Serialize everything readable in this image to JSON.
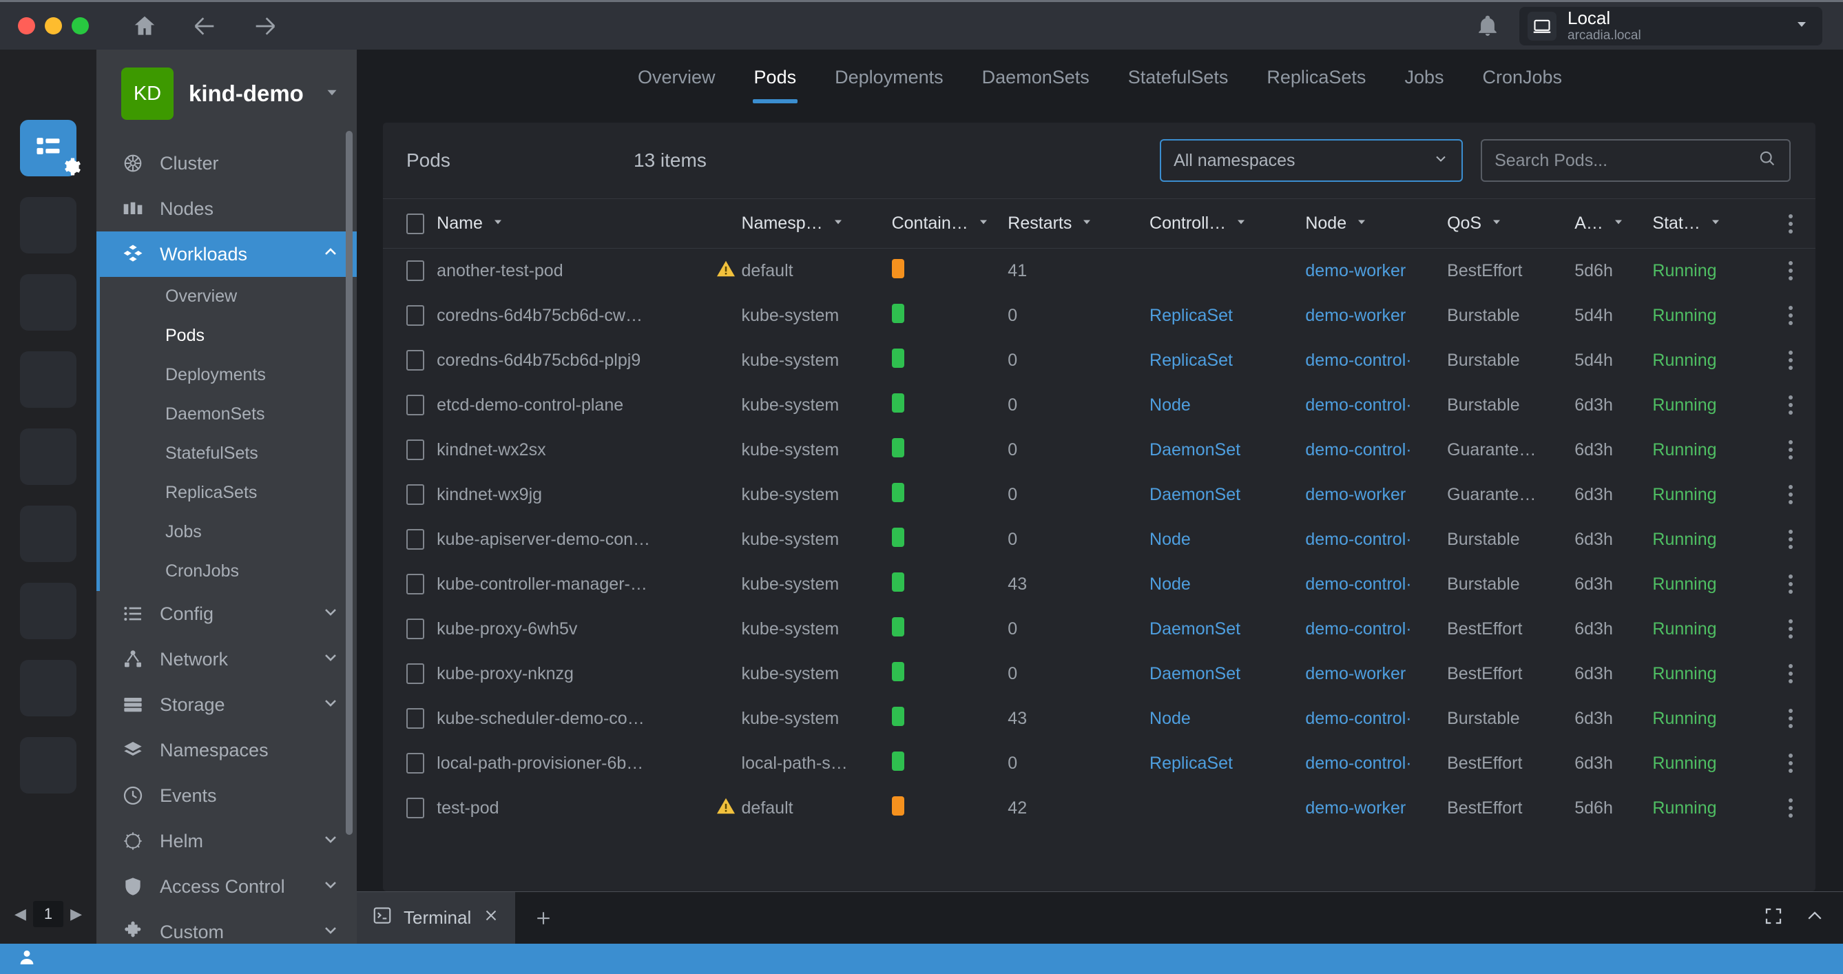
{
  "titlebar": {
    "home_icon": "home-icon",
    "back_icon": "back-arrow-icon",
    "forward_icon": "forward-arrow-icon",
    "bell_icon": "notification-bell-icon",
    "context": {
      "icon": "laptop-icon",
      "name": "Local",
      "host": "arcadia.local",
      "caret": "chevron-down-icon"
    }
  },
  "rail": {
    "active_icon": "cluster-list-icon",
    "gear_badge": "gear-icon",
    "placeholder_count": 8,
    "pagination": {
      "prev": "◀",
      "page": "1",
      "next": "▶"
    }
  },
  "sidebar": {
    "avatar_initials": "KD",
    "cluster_name": "kind-demo",
    "avatar_color": "#3d9900",
    "items": [
      {
        "label": "Cluster",
        "icon": "kubernetes-wheel-icon",
        "expandable": false
      },
      {
        "label": "Nodes",
        "icon": "server-rack-icon",
        "expandable": false
      },
      {
        "label": "Workloads",
        "icon": "cubes-icon",
        "expandable": true,
        "expanded": true,
        "active": true
      },
      {
        "label": "Config",
        "icon": "list-icon",
        "expandable": true
      },
      {
        "label": "Network",
        "icon": "network-nodes-icon",
        "expandable": true
      },
      {
        "label": "Storage",
        "icon": "storage-icon",
        "expandable": true
      },
      {
        "label": "Namespaces",
        "icon": "layers-icon",
        "expandable": false
      },
      {
        "label": "Events",
        "icon": "clock-icon",
        "expandable": false
      },
      {
        "label": "Helm",
        "icon": "helm-wheel-icon",
        "expandable": true
      },
      {
        "label": "Access Control",
        "icon": "shield-icon",
        "expandable": true
      },
      {
        "label": "Custom",
        "icon": "puzzle-icon",
        "expandable": true
      }
    ],
    "workload_children": [
      {
        "label": "Overview",
        "active": false
      },
      {
        "label": "Pods",
        "active": true
      },
      {
        "label": "Deployments",
        "active": false
      },
      {
        "label": "DaemonSets",
        "active": false
      },
      {
        "label": "StatefulSets",
        "active": false
      },
      {
        "label": "ReplicaSets",
        "active": false
      },
      {
        "label": "Jobs",
        "active": false
      },
      {
        "label": "CronJobs",
        "active": false
      }
    ]
  },
  "tabs": [
    {
      "label": "Overview",
      "active": false
    },
    {
      "label": "Pods",
      "active": true
    },
    {
      "label": "Deployments",
      "active": false
    },
    {
      "label": "DaemonSets",
      "active": false
    },
    {
      "label": "StatefulSets",
      "active": false
    },
    {
      "label": "ReplicaSets",
      "active": false
    },
    {
      "label": "Jobs",
      "active": false
    },
    {
      "label": "CronJobs",
      "active": false
    }
  ],
  "toolbar": {
    "title": "Pods",
    "count": "13 items",
    "namespace_value": "All namespaces",
    "namespace_caret": "chevron-down-icon",
    "search_placeholder": "Search Pods...",
    "search_value": "",
    "search_icon": "search-icon"
  },
  "table": {
    "columns": [
      {
        "label": "Name"
      },
      {
        "label": "Namesp…"
      },
      {
        "label": "Contain…"
      },
      {
        "label": "Restarts"
      },
      {
        "label": "Controll…"
      },
      {
        "label": "Node"
      },
      {
        "label": "QoS"
      },
      {
        "label": "A…"
      },
      {
        "label": "Stat…"
      }
    ],
    "overflow_icon": "kebab-menu-icon",
    "rows": [
      {
        "name": "another-test-pod",
        "warning": true,
        "namespace": "default",
        "container": "orange",
        "restarts": "41",
        "controller": "",
        "node": "demo-worker",
        "qos": "BestEffort",
        "age": "5d6h",
        "status": "Running"
      },
      {
        "name": "coredns-6d4b75cb6d-cw…",
        "warning": false,
        "namespace": "kube-system",
        "container": "green",
        "restarts": "0",
        "controller": "ReplicaSet",
        "node": "demo-worker",
        "qos": "Burstable",
        "age": "5d4h",
        "status": "Running"
      },
      {
        "name": "coredns-6d4b75cb6d-plpj9",
        "warning": false,
        "namespace": "kube-system",
        "container": "green",
        "restarts": "0",
        "controller": "ReplicaSet",
        "node": "demo-control·",
        "qos": "Burstable",
        "age": "5d4h",
        "status": "Running"
      },
      {
        "name": "etcd-demo-control-plane",
        "warning": false,
        "namespace": "kube-system",
        "container": "green",
        "restarts": "0",
        "controller": "Node",
        "node": "demo-control·",
        "qos": "Burstable",
        "age": "6d3h",
        "status": "Running"
      },
      {
        "name": "kindnet-wx2sx",
        "warning": false,
        "namespace": "kube-system",
        "container": "green",
        "restarts": "0",
        "controller": "DaemonSet",
        "node": "demo-control·",
        "qos": "Guarante…",
        "age": "6d3h",
        "status": "Running"
      },
      {
        "name": "kindnet-wx9jg",
        "warning": false,
        "namespace": "kube-system",
        "container": "green",
        "restarts": "0",
        "controller": "DaemonSet",
        "node": "demo-worker",
        "qos": "Guarante…",
        "age": "6d3h",
        "status": "Running"
      },
      {
        "name": "kube-apiserver-demo-con…",
        "warning": false,
        "namespace": "kube-system",
        "container": "green",
        "restarts": "0",
        "controller": "Node",
        "node": "demo-control·",
        "qos": "Burstable",
        "age": "6d3h",
        "status": "Running"
      },
      {
        "name": "kube-controller-manager-…",
        "warning": false,
        "namespace": "kube-system",
        "container": "green",
        "restarts": "43",
        "controller": "Node",
        "node": "demo-control·",
        "qos": "Burstable",
        "age": "6d3h",
        "status": "Running"
      },
      {
        "name": "kube-proxy-6wh5v",
        "warning": false,
        "namespace": "kube-system",
        "container": "green",
        "restarts": "0",
        "controller": "DaemonSet",
        "node": "demo-control·",
        "qos": "BestEffort",
        "age": "6d3h",
        "status": "Running"
      },
      {
        "name": "kube-proxy-nknzg",
        "warning": false,
        "namespace": "kube-system",
        "container": "green",
        "restarts": "0",
        "controller": "DaemonSet",
        "node": "demo-worker",
        "qos": "BestEffort",
        "age": "6d3h",
        "status": "Running"
      },
      {
        "name": "kube-scheduler-demo-co…",
        "warning": false,
        "namespace": "kube-system",
        "container": "green",
        "restarts": "43",
        "controller": "Node",
        "node": "demo-control·",
        "qos": "Burstable",
        "age": "6d3h",
        "status": "Running"
      },
      {
        "name": "local-path-provisioner-6b…",
        "warning": false,
        "namespace": "local-path-s…",
        "container": "green",
        "restarts": "0",
        "controller": "ReplicaSet",
        "node": "demo-control·",
        "qos": "BestEffort",
        "age": "6d3h",
        "status": "Running"
      },
      {
        "name": "test-pod",
        "warning": true,
        "namespace": "default",
        "container": "orange",
        "restarts": "42",
        "controller": "",
        "node": "demo-worker",
        "qos": "BestEffort",
        "age": "5d6h",
        "status": "Running"
      }
    ]
  },
  "terminal": {
    "tab_label": "Terminal",
    "tab_icon": "terminal-icon",
    "close_icon": "close-icon",
    "add_icon": "plus-icon",
    "fullscreen_icon": "fullscreen-icon",
    "collapse_icon": "chevron-up-icon"
  },
  "statusbar": {
    "user_icon": "user-icon"
  },
  "colors": {
    "accent": "#3b8ed0",
    "link": "#4e9fe0",
    "status_running": "#4fbf63",
    "container_ok": "#2fbf4f",
    "container_warn": "#f5911e",
    "warning": "#f2c13d"
  }
}
